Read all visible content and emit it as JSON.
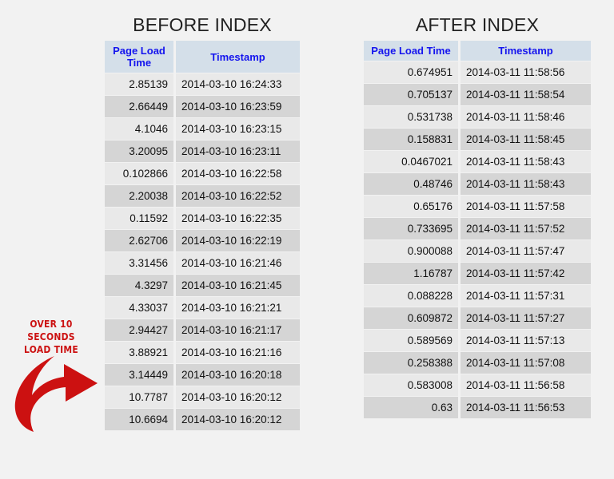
{
  "background_color": "#f2f2f2",
  "annotation": {
    "text": "OVER 10 SECONDS\nLOAD TIME",
    "color": "#cc1111",
    "arrow_icon": "curved-arrow-down-right-icon"
  },
  "tables": {
    "before": {
      "title": "BEFORE INDEX",
      "columns": [
        "Page Load Time",
        "Timestamp"
      ],
      "header_color": "#1414ee",
      "header_bg": "#d4dfe9",
      "rows": [
        {
          "page_load_time": "2.85139",
          "timestamp": "2014-03-10 16:24:33"
        },
        {
          "page_load_time": "2.66449",
          "timestamp": "2014-03-10 16:23:59"
        },
        {
          "page_load_time": "4.1046",
          "timestamp": "2014-03-10 16:23:15"
        },
        {
          "page_load_time": "3.20095",
          "timestamp": "2014-03-10 16:23:11"
        },
        {
          "page_load_time": "0.102866",
          "timestamp": "2014-03-10 16:22:58"
        },
        {
          "page_load_time": "2.20038",
          "timestamp": "2014-03-10 16:22:52"
        },
        {
          "page_load_time": "0.11592",
          "timestamp": "2014-03-10 16:22:35"
        },
        {
          "page_load_time": "2.62706",
          "timestamp": "2014-03-10 16:22:19"
        },
        {
          "page_load_time": "3.31456",
          "timestamp": "2014-03-10 16:21:46"
        },
        {
          "page_load_time": "4.3297",
          "timestamp": "2014-03-10 16:21:45"
        },
        {
          "page_load_time": "4.33037",
          "timestamp": "2014-03-10 16:21:21"
        },
        {
          "page_load_time": "2.94427",
          "timestamp": "2014-03-10 16:21:17"
        },
        {
          "page_load_time": "3.88921",
          "timestamp": "2014-03-10 16:21:16"
        },
        {
          "page_load_time": "3.14449",
          "timestamp": "2014-03-10 16:20:18"
        },
        {
          "page_load_time": "10.7787",
          "timestamp": "2014-03-10 16:20:12"
        },
        {
          "page_load_time": "10.6694",
          "timestamp": "2014-03-10 16:20:12"
        }
      ]
    },
    "after": {
      "title": "AFTER INDEX",
      "columns": [
        "Page Load Time",
        "Timestamp"
      ],
      "header_color": "#1414ee",
      "header_bg": "#d4dfe9",
      "rows": [
        {
          "page_load_time": "0.674951",
          "timestamp": "2014-03-11 11:58:56"
        },
        {
          "page_load_time": "0.705137",
          "timestamp": "2014-03-11 11:58:54"
        },
        {
          "page_load_time": "0.531738",
          "timestamp": "2014-03-11 11:58:46"
        },
        {
          "page_load_time": "0.158831",
          "timestamp": "2014-03-11 11:58:45"
        },
        {
          "page_load_time": "0.0467021",
          "timestamp": "2014-03-11 11:58:43"
        },
        {
          "page_load_time": "0.48746",
          "timestamp": "2014-03-11 11:58:43"
        },
        {
          "page_load_time": "0.65176",
          "timestamp": "2014-03-11 11:57:58"
        },
        {
          "page_load_time": "0.733695",
          "timestamp": "2014-03-11 11:57:52"
        },
        {
          "page_load_time": "0.900088",
          "timestamp": "2014-03-11 11:57:47"
        },
        {
          "page_load_time": "1.16787",
          "timestamp": "2014-03-11 11:57:42"
        },
        {
          "page_load_time": "0.088228",
          "timestamp": "2014-03-11 11:57:31"
        },
        {
          "page_load_time": "0.609872",
          "timestamp": "2014-03-11 11:57:27"
        },
        {
          "page_load_time": "0.589569",
          "timestamp": "2014-03-11 11:57:13"
        },
        {
          "page_load_time": "0.258388",
          "timestamp": "2014-03-11 11:57:08"
        },
        {
          "page_load_time": "0.583008",
          "timestamp": "2014-03-11 11:56:58"
        },
        {
          "page_load_time": "0.63",
          "timestamp": "2014-03-11 11:56:53"
        }
      ]
    }
  }
}
